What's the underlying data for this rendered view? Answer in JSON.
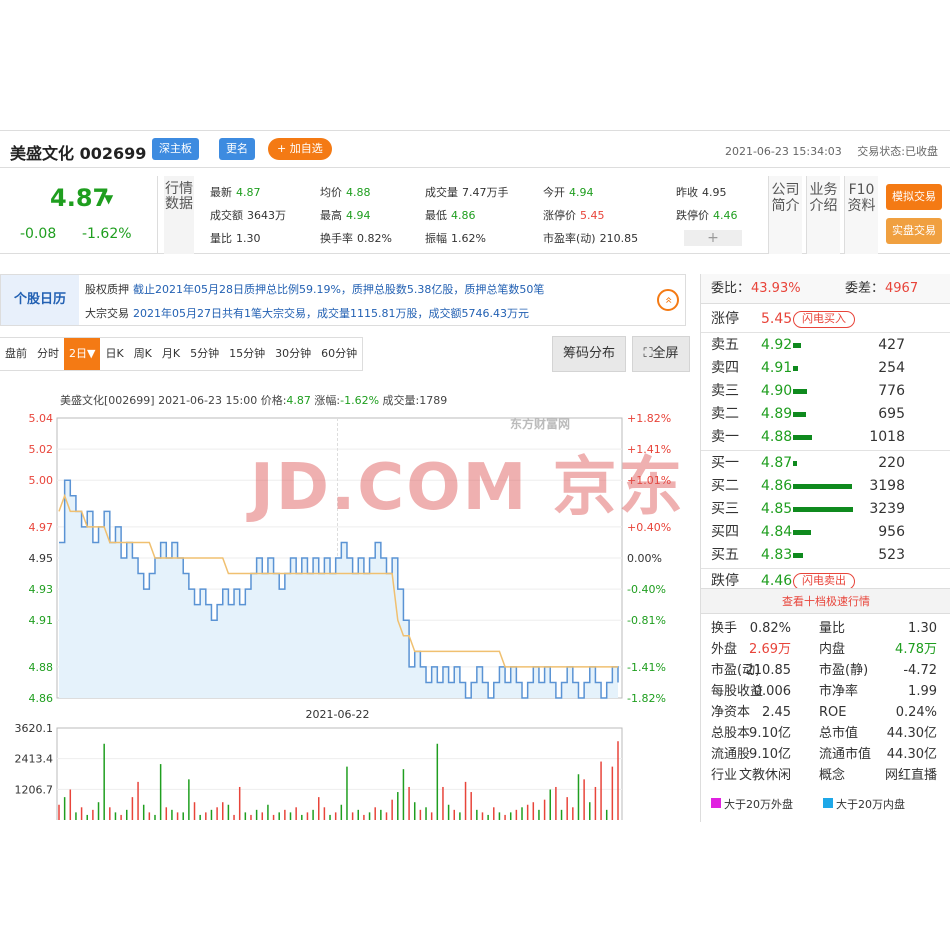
{
  "header": {
    "stock_name": "美盛文化 002699",
    "board_btn": "深主板",
    "rename_btn": "更名",
    "add_watch_btn": "+ 加自选",
    "datetime": "2021-06-23 15:34:03",
    "trade_status": "交易状态:已收盘"
  },
  "quote": {
    "price": "4.87",
    "arrow": "▼",
    "change": "-0.08",
    "change_pct": "-1.62%",
    "section_label": "行情数据",
    "fields": [
      {
        "k": "最新",
        "v": "4.87",
        "c": "green"
      },
      {
        "k": "成交额",
        "v": "3643万",
        "c": "plain"
      },
      {
        "k": "量比",
        "v": "1.30",
        "c": "plain"
      },
      {
        "k": "均价",
        "v": "4.88",
        "c": "green"
      },
      {
        "k": "最高",
        "v": "4.94",
        "c": "green"
      },
      {
        "k": "换手率",
        "v": "0.82%",
        "c": "plain"
      },
      {
        "k": "成交量",
        "v": "7.47万手",
        "c": "plain"
      },
      {
        "k": "最低",
        "v": "4.86",
        "c": "green"
      },
      {
        "k": "振幅",
        "v": "1.62%",
        "c": "plain"
      },
      {
        "k": "今开",
        "v": "4.94",
        "c": "green"
      },
      {
        "k": "涨停价",
        "v": "5.45",
        "c": "red"
      },
      {
        "k": "市盈率(动)",
        "v": "210.85",
        "c": "plain"
      },
      {
        "k": "昨收",
        "v": "4.95",
        "c": "plain"
      },
      {
        "k": "跌停价",
        "v": "4.46",
        "c": "green"
      }
    ],
    "plus": "+",
    "side_labels": [
      "公司简介",
      "业务介绍",
      "F10资料"
    ],
    "sim_trade": "模拟交易",
    "real_trade": "实盘交易"
  },
  "calendar": {
    "title": "个股日历",
    "lines": [
      {
        "k": "股权质押",
        "t": "截止2021年05月28日质押总比例59.19%，质押总股数5.38亿股，质押总笔数50笔"
      },
      {
        "k": "大宗交易",
        "t": "2021年05月27日共有1笔大宗交易，成交量1115.81万股，成交额5746.43万元"
      }
    ],
    "expand": "«"
  },
  "tabs": [
    "盘前",
    "分时",
    "2日▼",
    "日K",
    "周K",
    "月K",
    "5分钟",
    "15分钟",
    "30分钟",
    "60分钟"
  ],
  "buttons": {
    "chips": "筹码分布",
    "fullscreen": "⛶全屏"
  },
  "chart_info": {
    "prefix": "美盛文化[002699]  2021-06-23 15:00  价格:",
    "price": "4.87",
    "mid": "  涨幅:",
    "chg": "-1.62%",
    "suffix": "  成交量:1789"
  },
  "watermarks": {
    "eastmoney": "东方财富网",
    "jd": "JD.COM 京东"
  },
  "chart_data": {
    "type": "line",
    "y_ticks": [
      "5.04",
      "5.02",
      "5.00",
      "4.97",
      "4.95",
      "4.93",
      "4.91",
      "4.88",
      "4.86"
    ],
    "y_values": [
      5.04,
      5.02,
      5.0,
      4.97,
      4.95,
      4.93,
      4.91,
      4.88,
      4.86
    ],
    "pct_ticks": [
      "+1.82%",
      "+1.41%",
      "+1.01%",
      "+0.40%",
      "0.00%",
      "-0.40%",
      "-0.81%",
      "-1.41%",
      "-1.82%"
    ],
    "pct_colors": [
      "#e8443a",
      "#e8443a",
      "#e8443a",
      "#e8443a",
      "#333333",
      "#1f9e1f",
      "#1f9e1f",
      "#1f9e1f",
      "#1f9e1f"
    ],
    "ylim": [
      4.86,
      5.04
    ],
    "x_label": "2021-06-22",
    "price_series": [
      4.96,
      5.0,
      4.99,
      4.98,
      4.97,
      4.98,
      4.96,
      4.97,
      4.98,
      4.96,
      4.97,
      4.95,
      4.96,
      4.95,
      4.94,
      4.93,
      4.94,
      4.95,
      4.96,
      4.95,
      4.96,
      4.95,
      4.94,
      4.93,
      4.92,
      4.93,
      4.92,
      4.91,
      4.92,
      4.93,
      4.92,
      4.93,
      4.92,
      4.93,
      4.94,
      4.95,
      4.94,
      4.95,
      4.94,
      4.93,
      4.94,
      4.95,
      4.94,
      4.95,
      4.94,
      4.95,
      4.94,
      4.95,
      4.94,
      4.95,
      4.96,
      4.95,
      4.94,
      4.95,
      4.94,
      4.95,
      4.96,
      4.95,
      4.94,
      4.95,
      4.93,
      4.91,
      4.88,
      4.89,
      4.88,
      4.87,
      4.88,
      4.87,
      4.88,
      4.87,
      4.88,
      4.87,
      4.86,
      4.87,
      4.88,
      4.87,
      4.86,
      4.87,
      4.88,
      4.87,
      4.88,
      4.87,
      4.86,
      4.87,
      4.88,
      4.87,
      4.88,
      4.87,
      4.86,
      4.87,
      4.88,
      4.87,
      4.86,
      4.87,
      4.88,
      4.87,
      4.86,
      4.87,
      4.88,
      4.87
    ],
    "avg_series": [
      4.98,
      4.99,
      4.98,
      4.98,
      4.98,
      4.97,
      4.97,
      4.97,
      4.97,
      4.96,
      4.96,
      4.96,
      4.96,
      4.96,
      4.96,
      4.96,
      4.96,
      4.95,
      4.95,
      4.95,
      4.95,
      4.95,
      4.95,
      4.95,
      4.95,
      4.95,
      4.95,
      4.95,
      4.95,
      4.95,
      4.94,
      4.94,
      4.94,
      4.94,
      4.94,
      4.94,
      4.94,
      4.94,
      4.94,
      4.94,
      4.94,
      4.94,
      4.94,
      4.94,
      4.94,
      4.94,
      4.94,
      4.94,
      4.94,
      4.94,
      4.94,
      4.94,
      4.94,
      4.94,
      4.94,
      4.94,
      4.94,
      4.94,
      4.94,
      4.94,
      4.91,
      4.9,
      4.9,
      4.89,
      4.89,
      4.89,
      4.89,
      4.89,
      4.89,
      4.89,
      4.89,
      4.89,
      4.89,
      4.89,
      4.89,
      4.89,
      4.89,
      4.89,
      4.89,
      4.88,
      4.88,
      4.88,
      4.88,
      4.88,
      4.88,
      4.88,
      4.88,
      4.88,
      4.88,
      4.88,
      4.88,
      4.88,
      4.88,
      4.88,
      4.88,
      4.88,
      4.88,
      4.88,
      4.88,
      4.88
    ],
    "volume_ticks": [
      "3620.1",
      "2413.4",
      "1206.7"
    ],
    "volume_values": [
      3620.1,
      2413.4,
      1206.7
    ],
    "volume_max": 3620.1,
    "volume_series": [
      600,
      900,
      1200,
      300,
      500,
      200,
      400,
      700,
      3000,
      500,
      300,
      200,
      400,
      900,
      1500,
      600,
      300,
      200,
      2200,
      500,
      400,
      300,
      300,
      1600,
      700,
      200,
      300,
      400,
      500,
      700,
      600,
      200,
      1300,
      300,
      200,
      400,
      300,
      600,
      200,
      300,
      400,
      300,
      500,
      200,
      300,
      400,
      900,
      500,
      200,
      300,
      600,
      2100,
      300,
      400,
      200,
      300,
      500,
      400,
      300,
      800,
      1100,
      2000,
      1300,
      700,
      400,
      500,
      300,
      3000,
      1300,
      600,
      400,
      300,
      1500,
      1100,
      400,
      300,
      200,
      500,
      300,
      200,
      300,
      400,
      500,
      600,
      700,
      400,
      800,
      1200,
      1300,
      400,
      900,
      500,
      1800,
      1600,
      700,
      1300,
      2300,
      400,
      2100,
      3100
    ],
    "volume_colors": [
      "r",
      "g",
      "r",
      "g",
      "r",
      "g",
      "r",
      "g",
      "g",
      "r",
      "g",
      "r",
      "g",
      "r",
      "r",
      "g",
      "r",
      "g",
      "g",
      "r",
      "g",
      "r",
      "g",
      "g",
      "r",
      "g",
      "r",
      "g",
      "r",
      "r",
      "g",
      "r",
      "r",
      "g",
      "r",
      "g",
      "r",
      "g",
      "r",
      "g",
      "r",
      "g",
      "r",
      "g",
      "r",
      "g",
      "r",
      "r",
      "g",
      "r",
      "g",
      "g",
      "r",
      "g",
      "r",
      "g",
      "r",
      "g",
      "r",
      "r",
      "g",
      "g",
      "r",
      "g",
      "r",
      "g",
      "r",
      "g",
      "r",
      "g",
      "r",
      "g",
      "r",
      "r",
      "g",
      "r",
      "g",
      "r",
      "g",
      "r",
      "g",
      "r",
      "g",
      "r",
      "r",
      "g",
      "r",
      "g",
      "r",
      "g",
      "r",
      "r",
      "g",
      "r",
      "g",
      "r",
      "r",
      "g",
      "r",
      "r"
    ]
  },
  "orderbook": {
    "ratio_label": "委比：",
    "ratio_value": "43.93%",
    "diff_label": "委差：",
    "diff_value": "4967",
    "limit_up": {
      "label": "涨停",
      "price": "5.45",
      "btn": "闪电买入"
    },
    "asks": [
      {
        "label": "卖五",
        "price": "4.92",
        "vol": "427"
      },
      {
        "label": "卖四",
        "price": "4.91",
        "vol": "254"
      },
      {
        "label": "卖三",
        "price": "4.90",
        "vol": "776"
      },
      {
        "label": "卖二",
        "price": "4.89",
        "vol": "695"
      },
      {
        "label": "卖一",
        "price": "4.88",
        "vol": "1018"
      }
    ],
    "bids": [
      {
        "label": "买一",
        "price": "4.87",
        "vol": "220"
      },
      {
        "label": "买二",
        "price": "4.86",
        "vol": "3198"
      },
      {
        "label": "买三",
        "price": "4.85",
        "vol": "3239"
      },
      {
        "label": "买四",
        "price": "4.84",
        "vol": "956"
      },
      {
        "label": "买五",
        "price": "4.83",
        "vol": "523"
      }
    ],
    "limit_down": {
      "label": "跌停",
      "price": "4.46",
      "btn": "闪电卖出"
    },
    "ten_level": "查看十档极速行情",
    "max_vol": 3239
  },
  "stats": [
    [
      {
        "t": "换手",
        "c": "plain"
      },
      {
        "t": "0.82%",
        "c": "plain"
      },
      {
        "t": "量比",
        "c": "plain"
      },
      {
        "t": "1.30",
        "c": "plain"
      }
    ],
    [
      {
        "t": "外盘",
        "c": "plain"
      },
      {
        "t": "2.69万",
        "c": "red"
      },
      {
        "t": "内盘",
        "c": "plain"
      },
      {
        "t": "4.78万",
        "c": "green"
      }
    ],
    [
      {
        "t": "市盈(动)",
        "c": "plain"
      },
      {
        "t": "210.85",
        "c": "plain"
      },
      {
        "t": "市盈(静)",
        "c": "plain"
      },
      {
        "t": "-4.72",
        "c": "plain"
      }
    ],
    [
      {
        "t": "每股收益",
        "c": "plain"
      },
      {
        "t": "0.006",
        "c": "plain"
      },
      {
        "t": "市净率",
        "c": "plain"
      },
      {
        "t": "1.99",
        "c": "plain"
      }
    ],
    [
      {
        "t": "净资本",
        "c": "plain"
      },
      {
        "t": "2.45",
        "c": "plain"
      },
      {
        "t": "ROE",
        "c": "plain"
      },
      {
        "t": "0.24%",
        "c": "plain"
      }
    ],
    [
      {
        "t": "总股本",
        "c": "plain"
      },
      {
        "t": "9.10亿",
        "c": "plain"
      },
      {
        "t": "总市值",
        "c": "plain"
      },
      {
        "t": "44.30亿",
        "c": "plain"
      }
    ],
    [
      {
        "t": "流通股",
        "c": "plain"
      },
      {
        "t": "9.10亿",
        "c": "plain"
      },
      {
        "t": "流通市值",
        "c": "plain"
      },
      {
        "t": "44.30亿",
        "c": "plain"
      }
    ],
    [
      {
        "t": "行业",
        "c": "plain"
      },
      {
        "t": "文教休闲",
        "c": "plain"
      },
      {
        "t": "概念",
        "c": "plain"
      },
      {
        "t": "网红直播",
        "c": "plain"
      }
    ]
  ],
  "legend": [
    {
      "label": "大于20万外盘",
      "color": "#e020e0"
    },
    {
      "label": "大于20万内盘",
      "color": "#1ea8e8"
    }
  ]
}
